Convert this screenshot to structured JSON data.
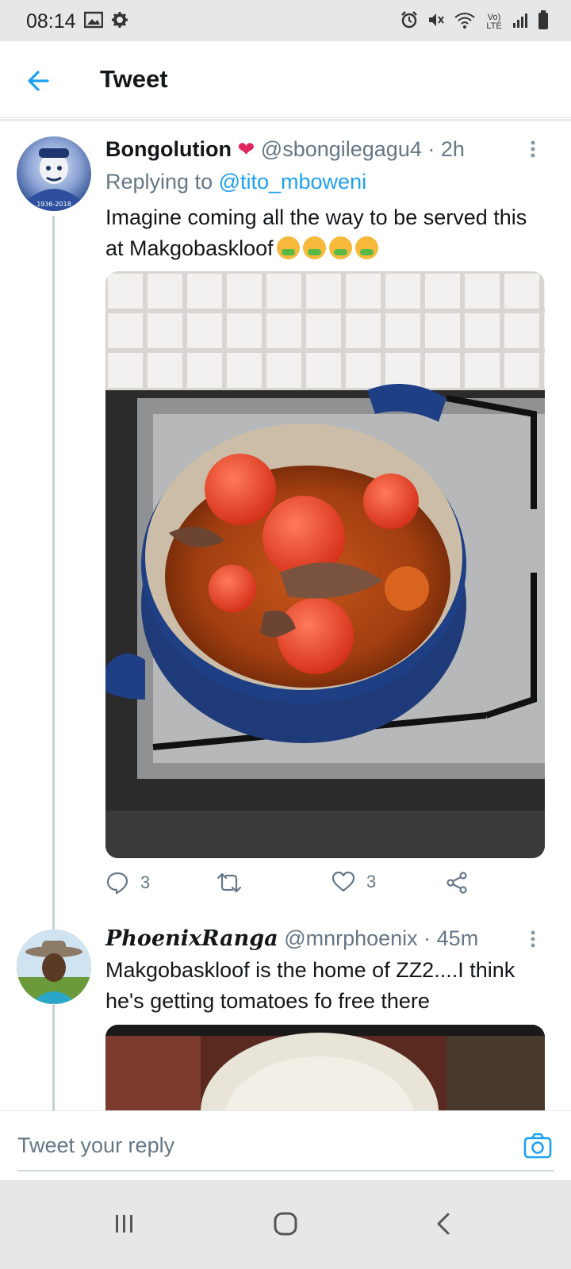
{
  "status_bar": {
    "time": "08:14",
    "left_icons": [
      "image-icon",
      "gear-icon"
    ],
    "right_icons": [
      "alarm-icon",
      "mute-icon",
      "wifi-icon",
      "volte-icon",
      "signal-icon",
      "battery-icon"
    ],
    "volte_label": "Vo) LTE"
  },
  "header": {
    "title": "Tweet",
    "back_icon": "back-arrow-icon"
  },
  "tweets": [
    {
      "name": "Bongolution",
      "badge": "❤",
      "handle": "@sbongilegagu4 · 2h",
      "replying_prefix": "Replying to ",
      "replying_to": "@tito_mboweni",
      "text": "Imagine coming all the way to be served this at Makgobaskloof",
      "avatar_caption": "1936-2018",
      "actions": {
        "reply_count": "3",
        "retweet_count": "",
        "like_count": "3"
      }
    },
    {
      "name": "PhoenixRanga",
      "handle": "@mnrphoenix · 45m",
      "text": "Makgobaskloof is the home of ZZ2....I think he's getting tomatoes fo free there"
    }
  ],
  "reply_bar": {
    "placeholder": "Tweet your reply"
  },
  "colors": {
    "accent": "#1da1f2",
    "muted": "#657786",
    "text": "#14171a"
  }
}
